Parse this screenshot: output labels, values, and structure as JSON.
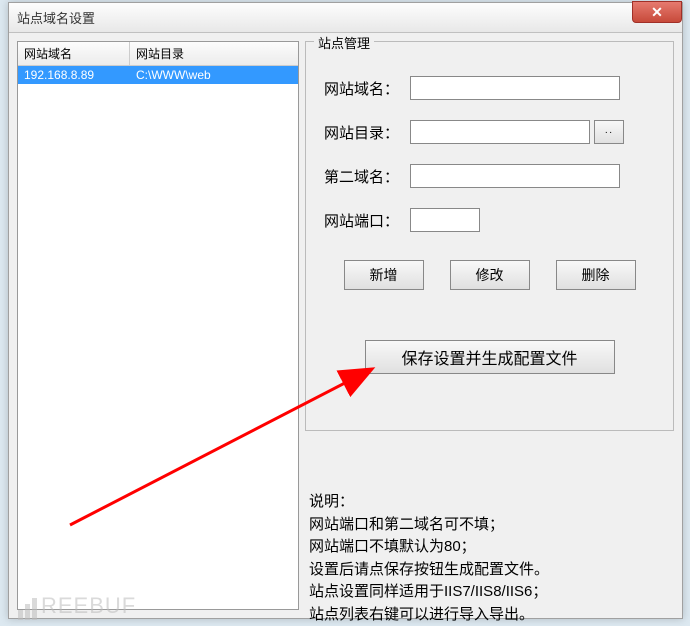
{
  "window": {
    "title": "站点域名设置"
  },
  "table": {
    "headers": {
      "domain": "网站域名",
      "dir": "网站目录"
    },
    "rows": [
      {
        "domain": "192.168.8.89",
        "dir": "C:\\WWW\\web"
      }
    ]
  },
  "group": {
    "title": "站点管理",
    "labels": {
      "domain": "网站域名：",
      "dir": "网站目录：",
      "second": "第二域名：",
      "port": "网站端口："
    },
    "inputs": {
      "domain": "",
      "dir": "",
      "second": "",
      "port": ""
    },
    "browse": "··",
    "buttons": {
      "add": "新增",
      "edit": "修改",
      "del": "删除",
      "save": "保存设置并生成配置文件"
    }
  },
  "desc": {
    "title": "说明：",
    "l1": "网站端口和第二域名可不填；",
    "l2": "网站端口不填默认为80；",
    "l3": "设置后请点保存按钮生成配置文件。",
    "l4": "站点设置同样适用于IIS7/IIS8/IIS6；",
    "l5": "站点列表右键可以进行导入导出。"
  },
  "watermark": "REEBUF"
}
